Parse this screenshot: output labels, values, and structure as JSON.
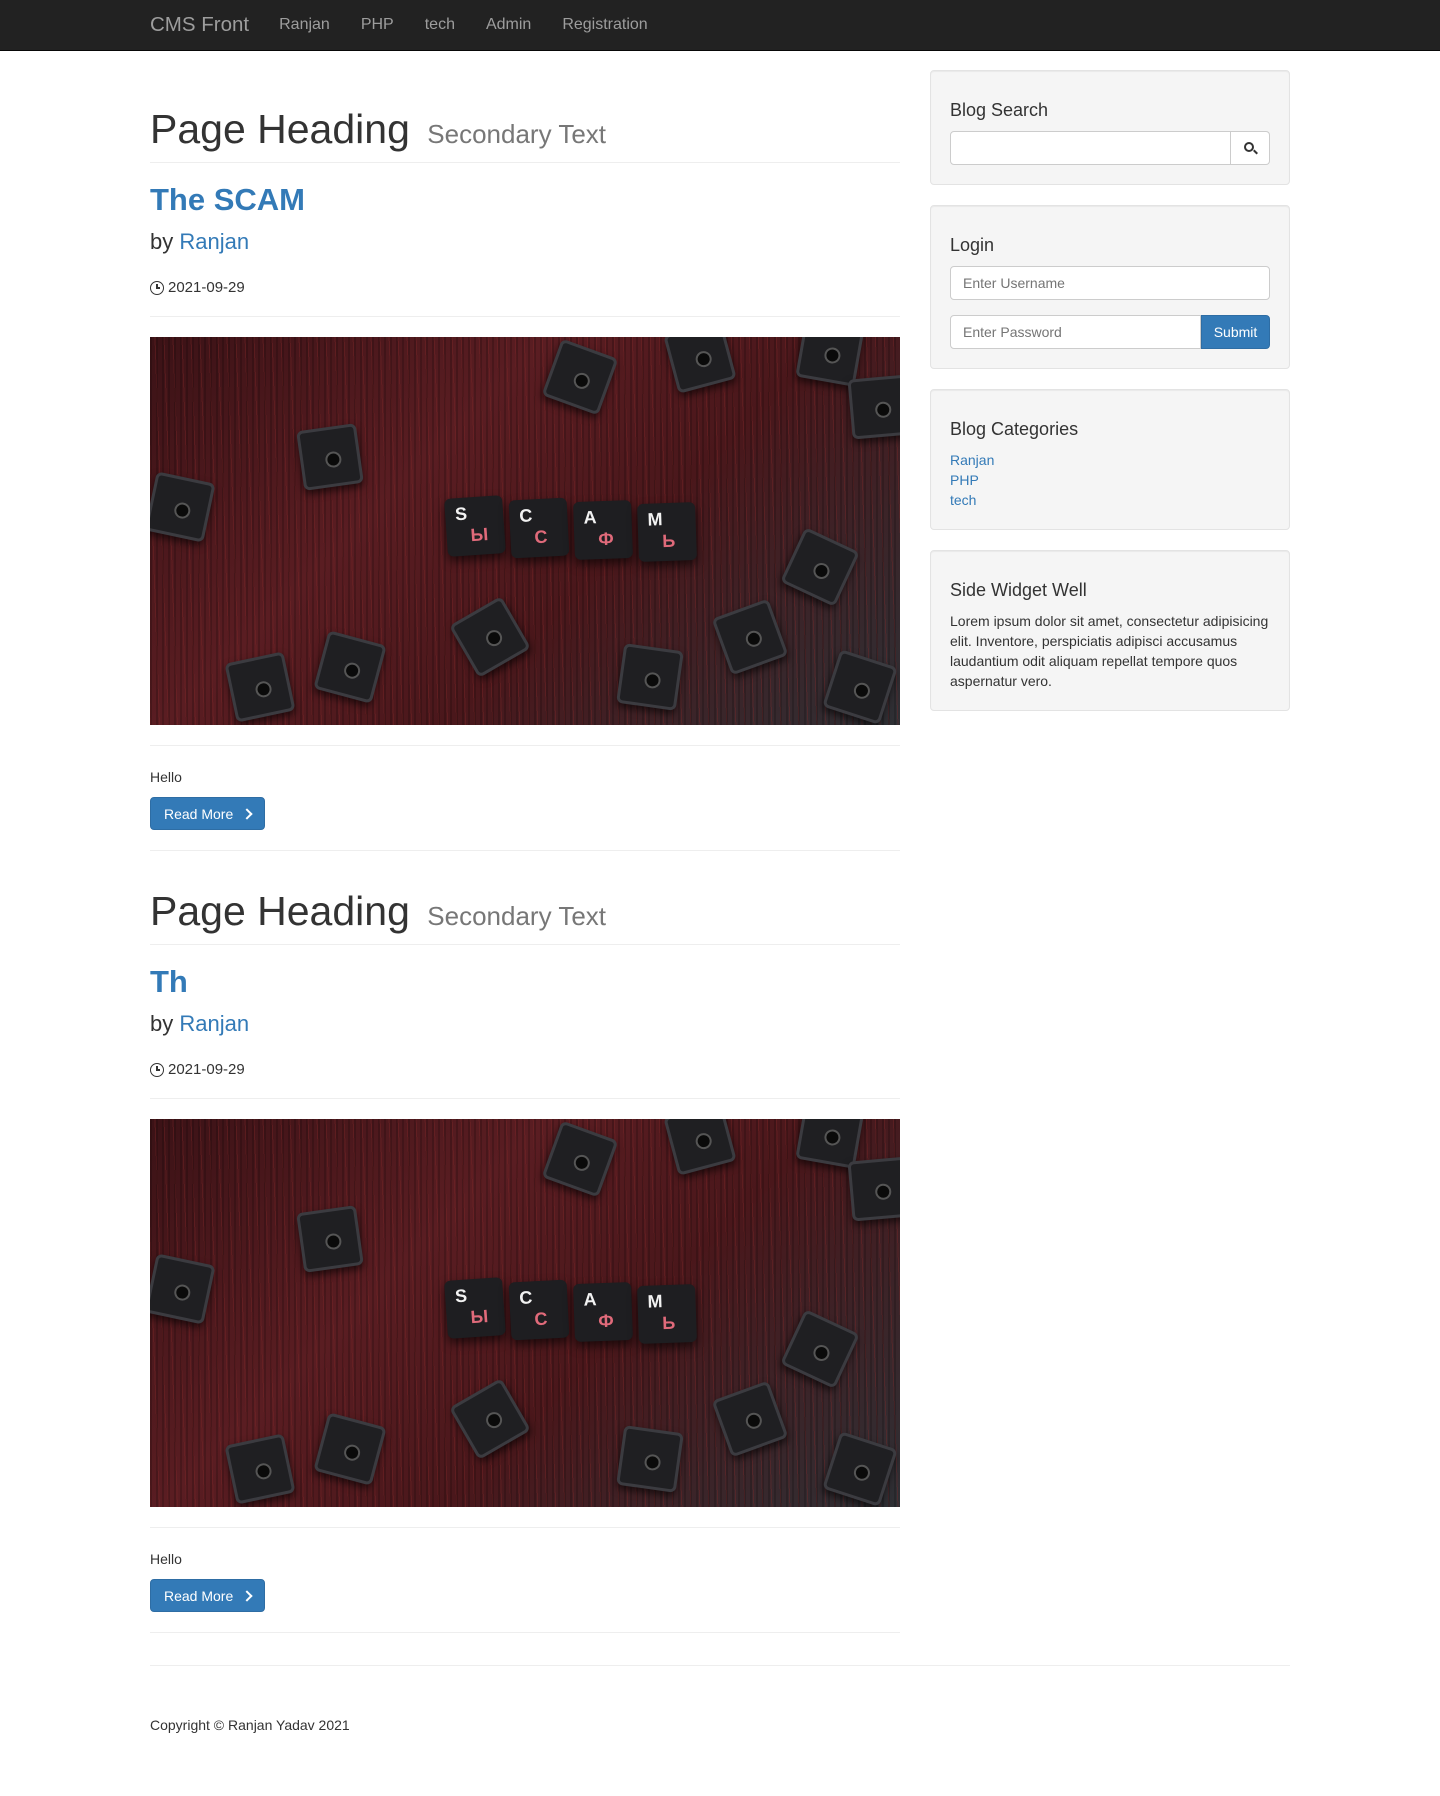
{
  "navbar": {
    "brand": "CMS Front",
    "links": [
      "Ranjan",
      "PHP",
      "tech",
      "Admin",
      "Registration"
    ]
  },
  "posts": [
    {
      "heading": "Page Heading",
      "subheading": "Secondary Text",
      "title": "The SCAM",
      "by_label": "by",
      "author": "Ranjan",
      "date": "2021-09-29",
      "excerpt": "Hello",
      "read_more": "Read More"
    },
    {
      "heading": "Page Heading",
      "subheading": "Secondary Text",
      "title": "Th",
      "by_label": "by",
      "author": "Ranjan",
      "date": "2021-09-29",
      "excerpt": "Hello",
      "read_more": "Read More"
    }
  ],
  "image_keys": {
    "top_row": [
      "S",
      "C",
      "A",
      "M"
    ],
    "bottom_row": [
      "Ы",
      "С",
      "Ф",
      "Ь"
    ]
  },
  "sidebar": {
    "search": {
      "title": "Blog Search",
      "placeholder": ""
    },
    "login": {
      "title": "Login",
      "username_placeholder": "Enter Username",
      "password_placeholder": "Enter Password",
      "submit_label": "Submit"
    },
    "categories": {
      "title": "Blog Categories",
      "items": [
        "Ranjan",
        "PHP",
        "tech"
      ]
    },
    "widget": {
      "title": "Side Widget Well",
      "text": "Lorem ipsum dolor sit amet, consectetur adipisicing elit. Inventore, perspiciatis adipisci accusamus laudantium odit aliquam repellat tempore quos aspernatur vero."
    }
  },
  "footer": {
    "copyright": "Copyright © Ranjan Yadav 2021"
  },
  "colors": {
    "link": "#337ab7",
    "navbar_bg": "#222222",
    "well_bg": "#f5f5f5"
  }
}
